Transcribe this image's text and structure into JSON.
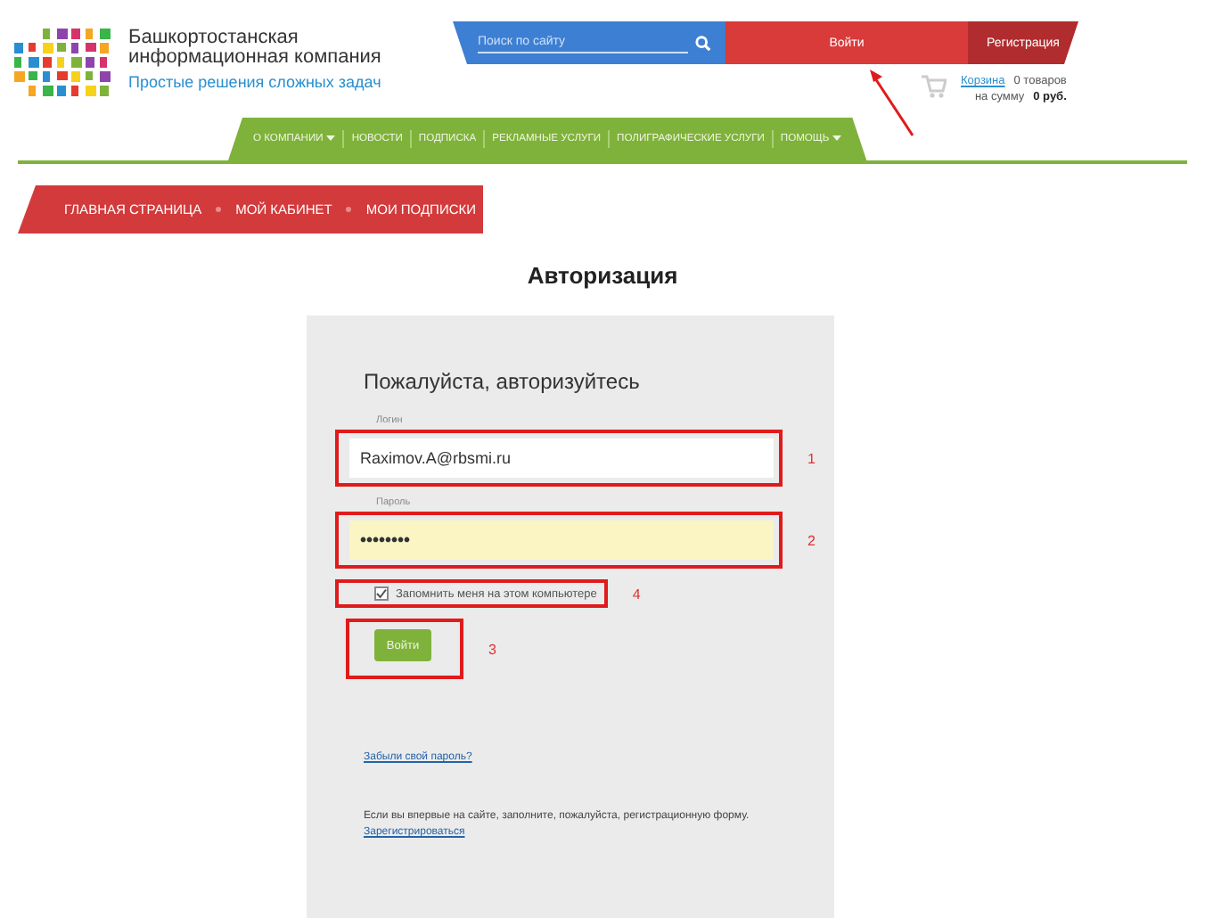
{
  "header": {
    "logo_lines": [
      "Башкортостанская",
      "информационная компания"
    ],
    "tagline": "Простые решения сложных задач",
    "search": {
      "placeholder": "Поиск по сайту"
    },
    "login": "Войти",
    "register": "Регистрация",
    "cart": {
      "link": "Корзина",
      "count": "0 товаров",
      "sum_label": "на сумму",
      "sum": "0 руб."
    }
  },
  "nav": [
    {
      "label": "О КОМПАНИИ",
      "dropdown": true
    },
    {
      "label": "НОВОСТИ",
      "dropdown": false
    },
    {
      "label": "ПОДПИСКА",
      "dropdown": false
    },
    {
      "label": "РЕКЛАМНЫЕ УСЛУГИ",
      "dropdown": false
    },
    {
      "label": "ПОЛИГРАФИЧЕСКИЕ УСЛУГИ",
      "dropdown": false
    },
    {
      "label": "ПОМОЩЬ",
      "dropdown": true
    }
  ],
  "breadcrumbs": [
    "ГЛАВНАЯ СТРАНИЦА",
    "МОЙ КАБИНЕТ",
    "МОИ ПОДПИСКИ"
  ],
  "title": "Авторизация",
  "form": {
    "heading": "Пожалуйста, авторизуйтесь",
    "fields": [
      {
        "label": "Логин",
        "value": "Raximov.A@rbsmi.ru",
        "autofilled": false,
        "annotation": "1"
      },
      {
        "label": "Пароль",
        "value": "••••••••",
        "autofilled": true,
        "annotation": "2"
      }
    ],
    "remember": {
      "label": "Запомнить меня на этом компьютере",
      "checked": true,
      "annotation": "4"
    },
    "submit": {
      "label": "Войти",
      "annotation": "3"
    },
    "forgot": "Забыли свой пароль?",
    "note": "Если вы впервые на сайте, заполните, пожалуйста, регистрационную форму.",
    "register_link": "Зарегистрироваться"
  }
}
